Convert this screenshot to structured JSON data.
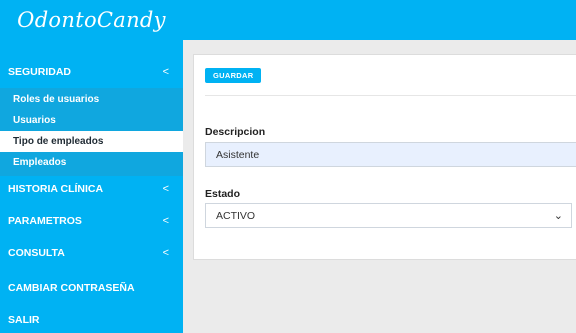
{
  "brand": {
    "title": "OdontoCandy"
  },
  "sidebar": {
    "items": [
      {
        "label": "SEGURIDAD",
        "chevron": "<"
      },
      {
        "label": "HISTORIA CLÍNICA",
        "chevron": "<"
      },
      {
        "label": "PARAMETROS",
        "chevron": "<"
      },
      {
        "label": "CONSULTA",
        "chevron": "<"
      },
      {
        "label": "CAMBIAR CONTRASEÑA"
      },
      {
        "label": "SALIR"
      }
    ],
    "subitems": [
      {
        "label": "Roles de usuarios"
      },
      {
        "label": "Usuarios"
      },
      {
        "label": "Tipo de empleados",
        "active": true
      },
      {
        "label": "Empleados"
      }
    ]
  },
  "form": {
    "save_label": "GUARDAR",
    "descripcion_label": "Descripcion",
    "descripcion_value": "Asistente",
    "estado_label": "Estado",
    "estado_value": "ACTIVO"
  },
  "colors": {
    "accent": "#00b2f3",
    "submenu_bg": "#10a7df",
    "autofill_bg": "#e8f0fe"
  },
  "icons": {
    "chevron": "chevron-left-icon",
    "select_caret": "chevron-down-icon"
  }
}
